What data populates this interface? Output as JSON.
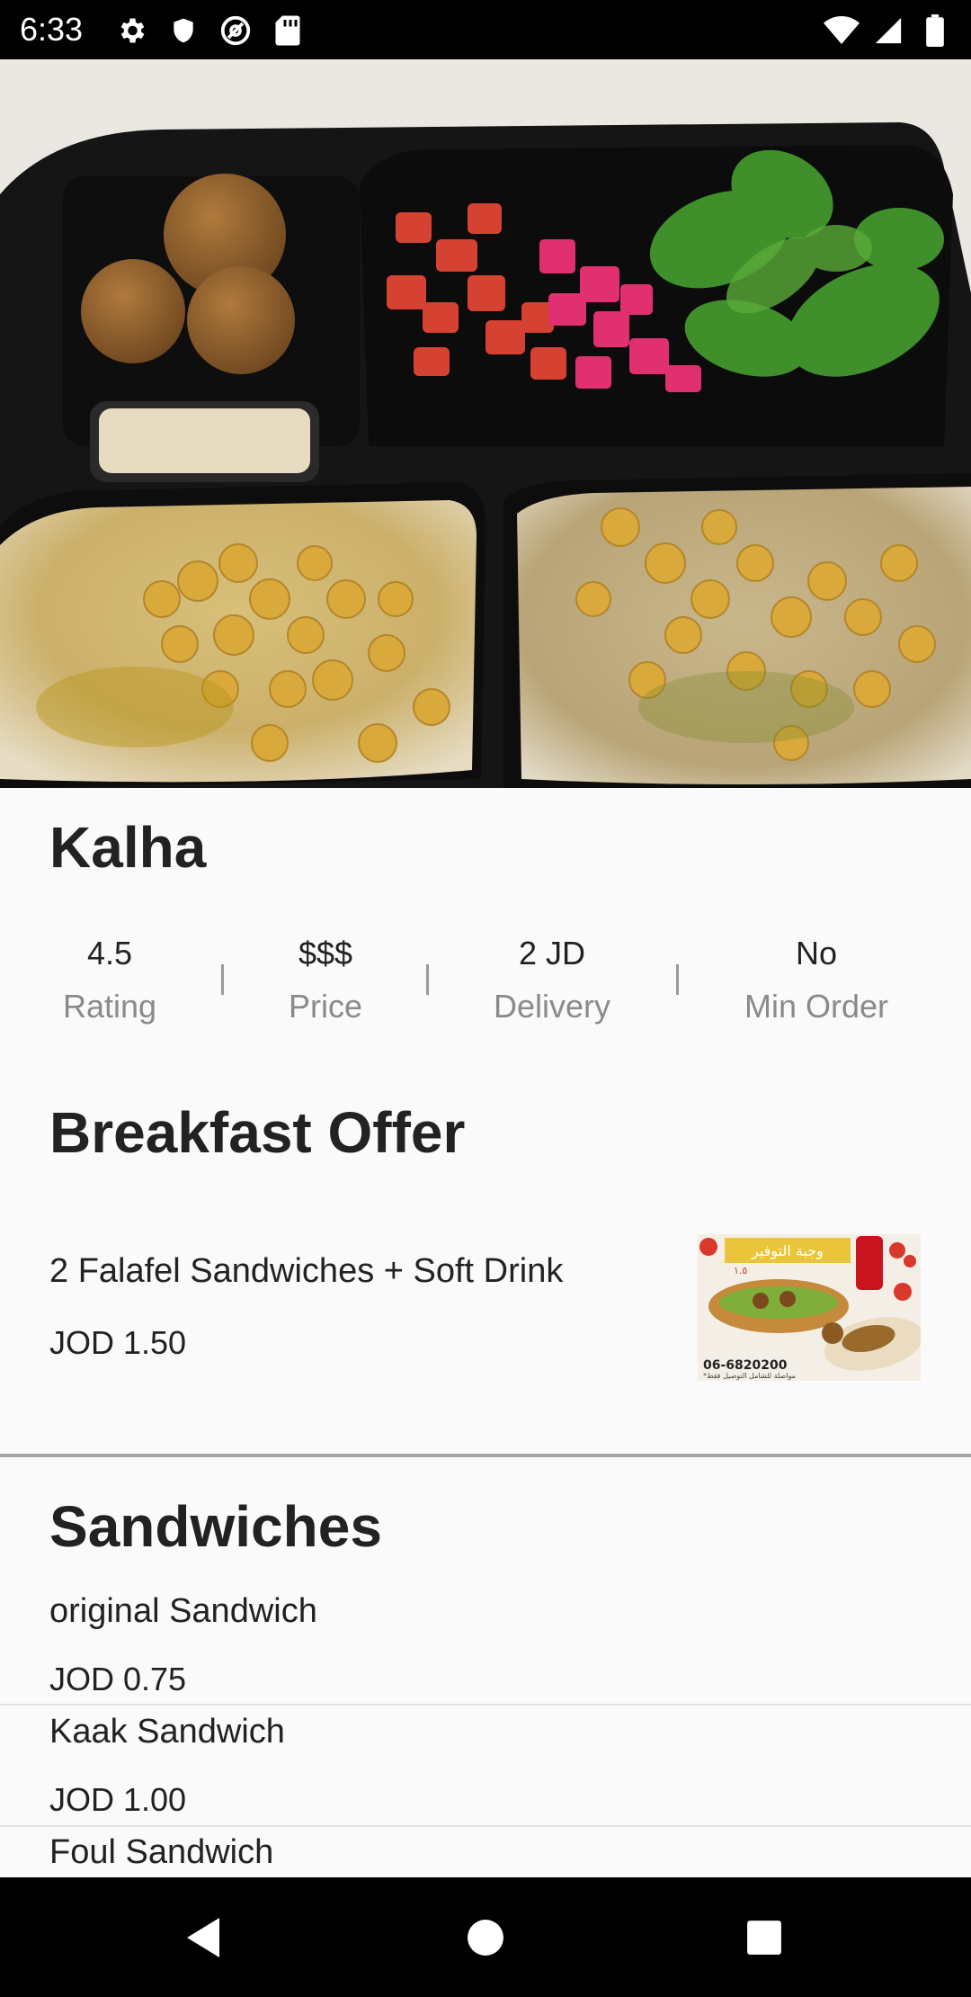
{
  "status_bar": {
    "time": "6:33",
    "left_icons": [
      "gear-icon",
      "shield-icon",
      "at-sign-icon",
      "sd-card-icon"
    ],
    "right_icons": [
      "wifi-icon",
      "signal-icon",
      "battery-icon"
    ]
  },
  "restaurant": {
    "name": "Kalha",
    "hero_image": "falafel-hummus-platter"
  },
  "stats": [
    {
      "value": "4.5",
      "label": "Rating"
    },
    {
      "value": "$$$",
      "label": "Price"
    },
    {
      "value": "2 JD",
      "label": "Delivery"
    },
    {
      "value": "No",
      "label": "Min Order"
    }
  ],
  "sections": {
    "offer": {
      "title": "Breakfast Offer",
      "item": {
        "name": "2 Falafel Sandwiches + Soft Drink",
        "price": "JOD 1.50",
        "thumb": {
          "banner_text": "وجبة التوفير",
          "price_badge": "١.٥",
          "phone": "06-6820200",
          "note": "*مواصلة للشامل التوصيل فقط"
        }
      }
    },
    "sandwiches": {
      "title": "Sandwiches",
      "items": [
        {
          "name": "original Sandwich",
          "price": "JOD 0.75"
        },
        {
          "name": "Kaak Sandwich",
          "price": "JOD 1.00"
        },
        {
          "name": "Foul Sandwich"
        }
      ]
    }
  },
  "nav_bar": {
    "buttons": [
      "back-icon",
      "home-icon",
      "recents-icon"
    ]
  }
}
